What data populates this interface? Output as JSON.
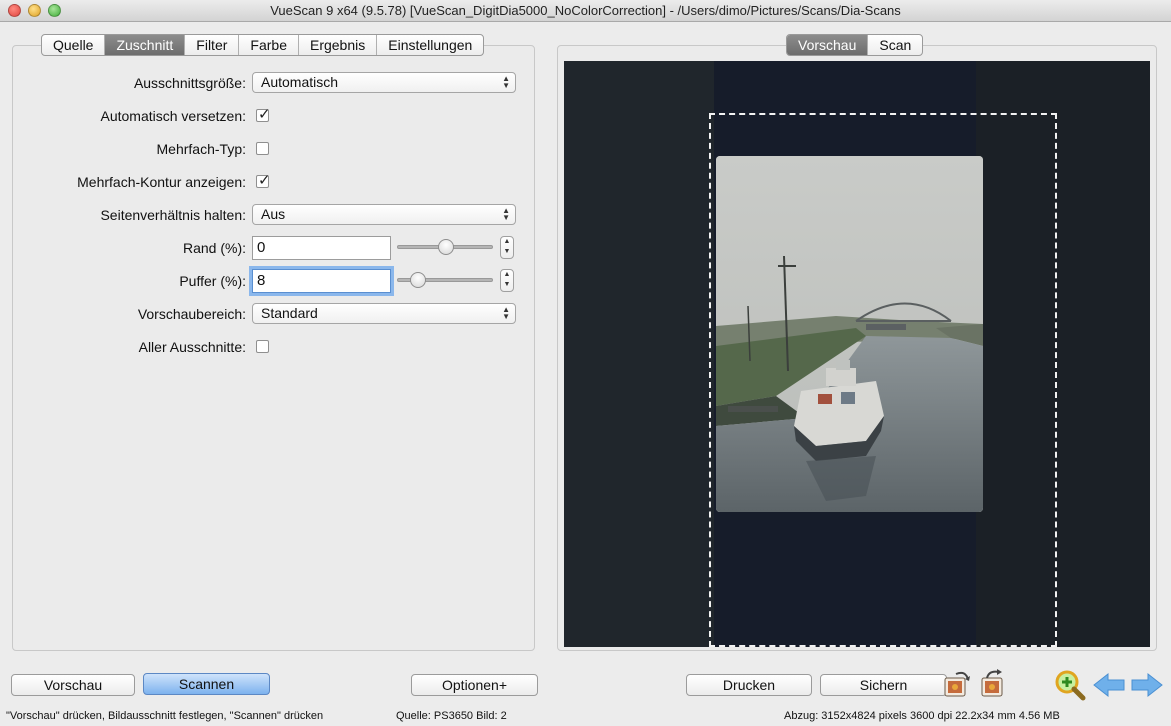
{
  "window": {
    "title": "VueScan 9 x64 (9.5.78) [VueScan_DigitDia5000_NoColorCorrection] - /Users/dimo/Pictures/Scans/Dia-Scans"
  },
  "left_tabs": [
    {
      "label": "Quelle",
      "active": false
    },
    {
      "label": "Zuschnitt",
      "active": true
    },
    {
      "label": "Filter",
      "active": false
    },
    {
      "label": "Farbe",
      "active": false
    },
    {
      "label": "Ergebnis",
      "active": false
    },
    {
      "label": "Einstellungen",
      "active": false
    }
  ],
  "right_tabs": [
    {
      "label": "Vorschau",
      "active": true
    },
    {
      "label": "Scan",
      "active": false
    }
  ],
  "form": {
    "crop_size": {
      "label": "Ausschnittsgröße:",
      "value": "Automatisch"
    },
    "auto_offset": {
      "label": "Automatisch versetzen:",
      "checked": true
    },
    "multi_type": {
      "label": "Mehrfach-Typ:",
      "checked": false
    },
    "multi_outline": {
      "label": "Mehrfach-Kontur anzeigen:",
      "checked": true
    },
    "aspect_ratio": {
      "label": "Seitenverhältnis halten:",
      "value": "Aus"
    },
    "border": {
      "label": "Rand (%):",
      "value": "0",
      "slider": 0.5
    },
    "buffer": {
      "label": "Puffer (%):",
      "value": "8",
      "slider": 0.22
    },
    "preview_area": {
      "label": "Vorschaubereich:",
      "value": "Standard"
    },
    "all_crops": {
      "label": "Aller Ausschnitte:",
      "checked": false
    }
  },
  "buttons": {
    "preview": "Vorschau",
    "scan": "Scannen",
    "options": "Optionen+",
    "print": "Drucken",
    "save": "Sichern"
  },
  "icons": {
    "rotate_left": "rotate-left-icon",
    "rotate_right": "rotate-right-icon",
    "zoom": "zoom-in-icon",
    "prev": "arrow-left-icon",
    "next": "arrow-right-icon"
  },
  "status": {
    "hint": "\"Vorschau\" drücken, Bildausschnitt festlegen, \"Scannen\" drücken",
    "source": "Quelle: PS3650 Bild: 2",
    "output": "Abzug: 3152x4824 pixels 3600 dpi 22.2x34 mm 4.56 MB"
  },
  "colors": {
    "accent": "#7db2ee",
    "focus_ring": "#8ab7ec",
    "preview_bg": "#1c2025"
  }
}
